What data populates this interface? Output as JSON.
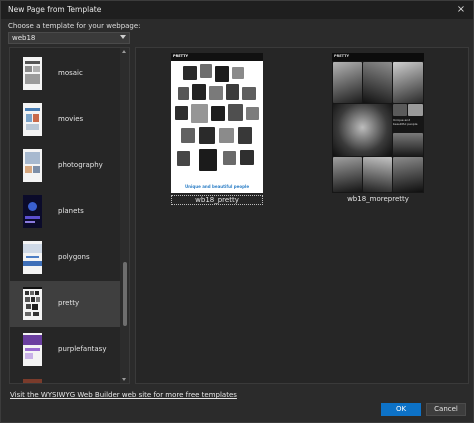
{
  "window": {
    "title": "New Page from Template",
    "close_icon": "×"
  },
  "prompt": "Choose a template for your webpage:",
  "combo": {
    "value": "web18"
  },
  "templates": [
    {
      "label": "mosaic",
      "selected": false
    },
    {
      "label": "movies",
      "selected": false
    },
    {
      "label": "photography",
      "selected": false
    },
    {
      "label": "planets",
      "selected": false
    },
    {
      "label": "polygons",
      "selected": false
    },
    {
      "label": "pretty",
      "selected": true
    },
    {
      "label": "purplefantasy",
      "selected": false
    }
  ],
  "previews": [
    {
      "caption": "wb18_pretty",
      "logo": "PRETTY",
      "tagline": "Unique and beautiful people"
    },
    {
      "caption": "wb18_morepretty",
      "logo": "PRETTY",
      "side_text": "Unique and beautiful people"
    }
  ],
  "footer": {
    "link": "Visit the WYSIWYG Web Builder web site for more free templates",
    "ok": "OK",
    "cancel": "Cancel"
  },
  "colors": {
    "accent": "#0d72c7",
    "tagline": "#2f80c7"
  }
}
